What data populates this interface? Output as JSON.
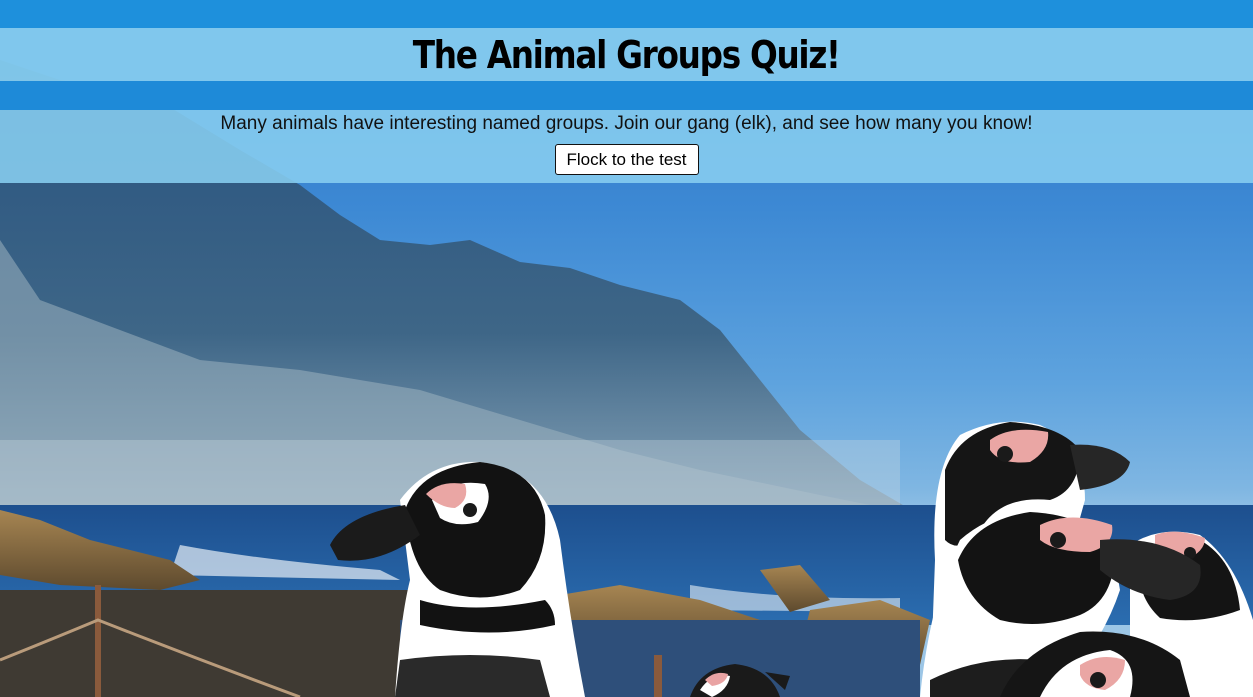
{
  "page": {
    "title": "The Animal Groups Quiz!",
    "intro": "Many animals have interesting named groups. Join our gang (elk), and see how many you know!",
    "cta_label": "Flock to the test"
  },
  "colors": {
    "top_strip": "#1e90dc",
    "title_band": "#87cef0",
    "button_bg": "#ffffff",
    "button_border": "#111111"
  },
  "background_image": {
    "subject": "penguins-on-rocky-coast-with-mountain"
  }
}
